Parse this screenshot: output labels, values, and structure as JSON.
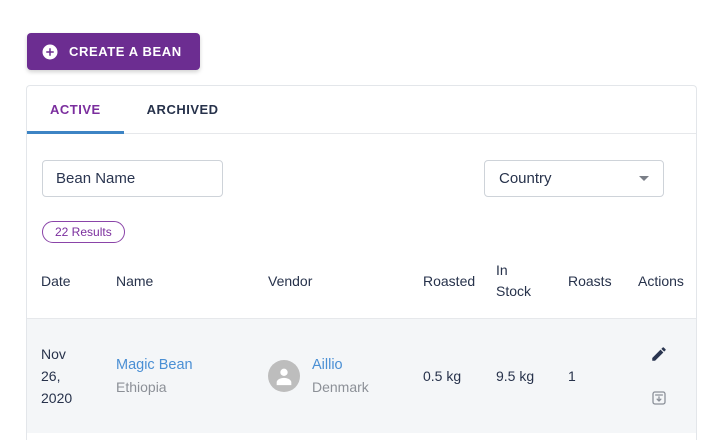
{
  "create_button": {
    "label": "CREATE A BEAN"
  },
  "tabs": {
    "active_label": "ACTIVE",
    "archived_label": "ARCHIVED"
  },
  "filters": {
    "bean_name_placeholder": "Bean Name",
    "country_value": "Country"
  },
  "results_chip": {
    "label": "22 Results"
  },
  "table": {
    "columns": [
      "Date",
      "Name",
      "Vendor",
      "Roasted",
      "In Stock",
      "Roasts",
      "Actions"
    ],
    "rows": [
      {
        "date": "Nov 26, 2020",
        "name": "Magic Bean",
        "origin": "Ethiopia",
        "vendor_name": "Aillio",
        "vendor_location": "Denmark",
        "roasted": "0.5 kg",
        "in_stock": "9.5 kg",
        "roasts": "1"
      }
    ]
  },
  "icons": {
    "create": "plus-circle-icon",
    "country": "chevron-down-icon",
    "vendor": "person-icon",
    "edit": "pencil-icon",
    "archive": "archive-box-icon"
  },
  "colors": {
    "primary_purple": "#6C2D91",
    "chip_purple": "#7B2E9E",
    "link_blue": "#4A8FD4",
    "tab_indicator_blue": "#3D84C4",
    "text_navy": "#27324B",
    "text_gray": "#8C9097",
    "row_bg": "#F4F6F8"
  }
}
